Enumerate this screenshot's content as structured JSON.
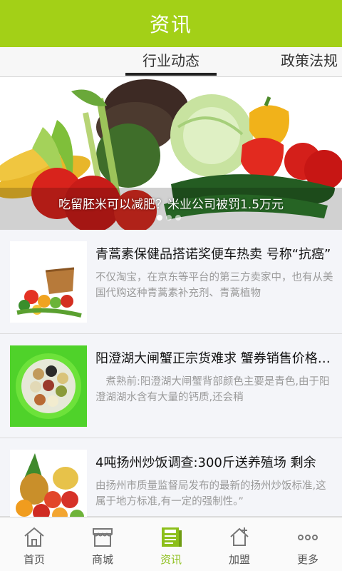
{
  "header": {
    "title": "资讯"
  },
  "tabs": [
    {
      "label": "行业动态",
      "active": true
    },
    {
      "label": "政策法规",
      "active": false
    }
  ],
  "banner": {
    "caption": "吃留胚米可以减肥？米业公司被罚1.5万元",
    "page_count": 3,
    "current_page": 1
  },
  "news": [
    {
      "title": "青蒿素保健品搭诺奖便车热卖 号称“抗癌”",
      "desc": "不仅淘宝，在京东等平台的第三方卖家中，也有从美国代购这种青蒿素补充剂、青蒿植物",
      "thumb_icon": "vegetable-basket-icon"
    },
    {
      "title": "阳澄湖大闸蟹正宗货难求 蟹券销售价格暴跌",
      "desc": "　煮熟前:阳澄湖大闸蟹背部颜色主要是青色,由于阳澄湖湖水含有大量的钙质,还会稍",
      "thumb_icon": "grain-bowls-icon"
    },
    {
      "title": "4吨扬州炒饭调查:300斤送养殖场 剩余",
      "desc": "由扬州市质量监督局发布的最新的扬州炒饭标准,这属于地方标准,有一定的强制性。”",
      "thumb_icon": "fruit-pile-icon"
    }
  ],
  "bottom_nav": [
    {
      "label": "首页",
      "icon": "home-icon",
      "active": false
    },
    {
      "label": "商城",
      "icon": "store-icon",
      "active": false
    },
    {
      "label": "资讯",
      "icon": "news-icon",
      "active": true
    },
    {
      "label": "加盟",
      "icon": "join-icon",
      "active": false
    },
    {
      "label": "更多",
      "icon": "more-icon",
      "active": false
    }
  ],
  "colors": {
    "brand": "#a3d017",
    "active_nav": "#8cbf1a"
  }
}
